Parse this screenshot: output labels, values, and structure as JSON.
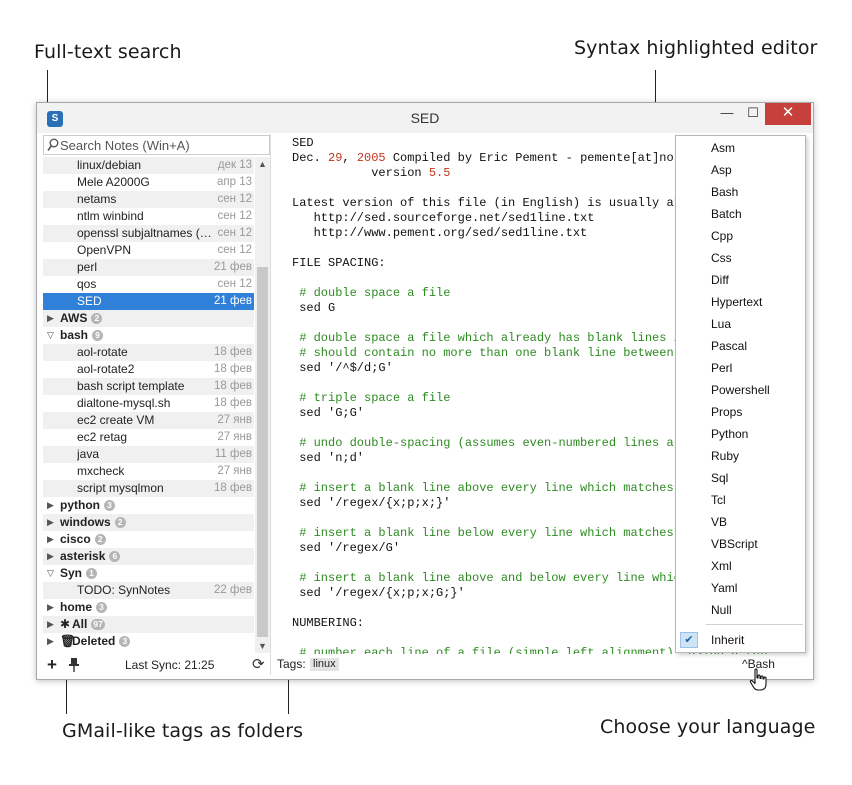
{
  "callouts": {
    "search": "Full-text search",
    "editor": "Syntax highlighted editor",
    "tags": "GMail-like tags as folders",
    "language": "Choose your language"
  },
  "window": {
    "title": "SED",
    "minimize": "—",
    "maximize": "☐",
    "close": "✕"
  },
  "search": {
    "placeholder": "Search Notes (Win+A)"
  },
  "tree": [
    {
      "kind": "note",
      "title": "linux/debian",
      "date": "дек 13"
    },
    {
      "kind": "note",
      "title": "Mele A2000G",
      "date": "апр 13"
    },
    {
      "kind": "note",
      "title": "netams",
      "date": "сен 12"
    },
    {
      "kind": "note",
      "title": "ntlm winbind",
      "date": "сен 12"
    },
    {
      "kind": "note",
      "title": "openssl subjaltnames (S...",
      "date": "сен 12"
    },
    {
      "kind": "note",
      "title": "OpenVPN",
      "date": "сен 12"
    },
    {
      "kind": "note",
      "title": "perl",
      "date": "21 фев"
    },
    {
      "kind": "note",
      "title": "qos",
      "date": "сен 12"
    },
    {
      "kind": "note",
      "title": "SED",
      "date": "21 фев",
      "selected": true
    },
    {
      "kind": "folder",
      "title": "AWS",
      "count": "2",
      "open": false
    },
    {
      "kind": "folder",
      "title": "bash",
      "count": "9",
      "open": true
    },
    {
      "kind": "note",
      "title": "aol-rotate",
      "date": "18 фев"
    },
    {
      "kind": "note",
      "title": "aol-rotate2",
      "date": "18 фев"
    },
    {
      "kind": "note",
      "title": "bash script template",
      "date": "18 фев"
    },
    {
      "kind": "note",
      "title": "dialtone-mysql.sh",
      "date": "18 фев"
    },
    {
      "kind": "note",
      "title": "ec2 create VM",
      "date": "27 янв"
    },
    {
      "kind": "note",
      "title": "ec2 retag",
      "date": "27 янв"
    },
    {
      "kind": "note",
      "title": "java",
      "date": "11 фев"
    },
    {
      "kind": "note",
      "title": "mxcheck",
      "date": "27 янв"
    },
    {
      "kind": "note",
      "title": "script mysqlmon",
      "date": "18 фев"
    },
    {
      "kind": "folder",
      "title": "python",
      "count": "3",
      "open": false
    },
    {
      "kind": "folder",
      "title": "windows",
      "count": "2",
      "open": false
    },
    {
      "kind": "folder",
      "title": "cisco",
      "count": "2",
      "open": false
    },
    {
      "kind": "folder",
      "title": "asterisk",
      "count": "6",
      "open": false
    },
    {
      "kind": "folder",
      "title": "Syn",
      "count": "1",
      "open": true
    },
    {
      "kind": "note",
      "title": "TODO: SynNotes",
      "date": "22 фев"
    },
    {
      "kind": "folder",
      "title": "home",
      "count": "3",
      "open": false
    },
    {
      "kind": "folder",
      "title": "All",
      "count": "97",
      "open": false,
      "icon": "✱"
    },
    {
      "kind": "folder",
      "title": "Deleted",
      "count": "3",
      "open": false,
      "icon": "🗑"
    }
  ],
  "leftbar": {
    "add": "+",
    "sync": "Last Sync: 21:25",
    "refresh": "⟳"
  },
  "editor": {
    "lines": [
      [
        {
          "t": "SED"
        }
      ],
      [
        {
          "t": "Dec. "
        },
        {
          "t": "29",
          "c": "num"
        },
        {
          "t": ", "
        },
        {
          "t": "2005",
          "c": "num"
        },
        {
          "t": " Compiled by Eric Pement - pemente[at]northpark[dot]edu"
        }
      ],
      [
        {
          "t": "           version "
        },
        {
          "t": "5.5",
          "c": "num"
        }
      ],
      [
        {
          "t": ""
        }
      ],
      [
        {
          "t": "Latest version of this file (in English) is usually at:"
        }
      ],
      [
        {
          "t": "   http://sed.sourceforge.net/sed1line.txt"
        }
      ],
      [
        {
          "t": "   http://www.pement.org/sed/sed1line.txt"
        }
      ],
      [
        {
          "t": ""
        }
      ],
      [
        {
          "t": "FILE SPACING:"
        }
      ],
      [
        {
          "t": ""
        }
      ],
      [
        {
          "t": " # double space a file",
          "c": "comment"
        }
      ],
      [
        {
          "t": " sed G"
        }
      ],
      [
        {
          "t": ""
        }
      ],
      [
        {
          "t": " # double space a file which already has blank lines in it. Output file",
          "c": "comment"
        }
      ],
      [
        {
          "t": " # should contain no more than one blank line between lines of text.",
          "c": "comment"
        }
      ],
      [
        {
          "t": " sed '/^$/d;G'"
        }
      ],
      [
        {
          "t": ""
        }
      ],
      [
        {
          "t": " # triple space a file",
          "c": "comment"
        }
      ],
      [
        {
          "t": " sed 'G;G'"
        }
      ],
      [
        {
          "t": ""
        }
      ],
      [
        {
          "t": " # undo double-spacing (assumes even-numbered lines are always blank)",
          "c": "comment"
        }
      ],
      [
        {
          "t": " sed 'n;d'"
        }
      ],
      [
        {
          "t": ""
        }
      ],
      [
        {
          "t": " # insert a blank line above every line which matches \"regex\"",
          "c": "comment"
        }
      ],
      [
        {
          "t": " sed '/regex/{x;p;x;}'"
        }
      ],
      [
        {
          "t": ""
        }
      ],
      [
        {
          "t": " # insert a blank line below every line which matches \"regex\"",
          "c": "comment"
        }
      ],
      [
        {
          "t": " sed '/regex/G'"
        }
      ],
      [
        {
          "t": ""
        }
      ],
      [
        {
          "t": " # insert a blank line above and below every line which matches \"regex\"",
          "c": "comment"
        }
      ],
      [
        {
          "t": " sed '/regex/{x;p;x;G;}'"
        }
      ],
      [
        {
          "t": ""
        }
      ],
      [
        {
          "t": "NUMBERING:"
        }
      ],
      [
        {
          "t": ""
        }
      ],
      [
        {
          "t": " # number each line of a file (simple left alignment). Using a tab",
          "c": "comment"
        }
      ]
    ]
  },
  "tagsbar": {
    "label": "Tags:",
    "tag": "linux",
    "language": "^Bash"
  },
  "languages": [
    "Asm",
    "Asp",
    "Bash",
    "Batch",
    "Cpp",
    "Css",
    "Diff",
    "Hypertext",
    "Lua",
    "Pascal",
    "Perl",
    "Powershell",
    "Props",
    "Python",
    "Ruby",
    "Sql",
    "Tcl",
    "VB",
    "VBScript",
    "Xml",
    "Yaml",
    "Null"
  ],
  "language_inherit": {
    "label": "Inherit",
    "checked": true,
    "check": "✔"
  }
}
